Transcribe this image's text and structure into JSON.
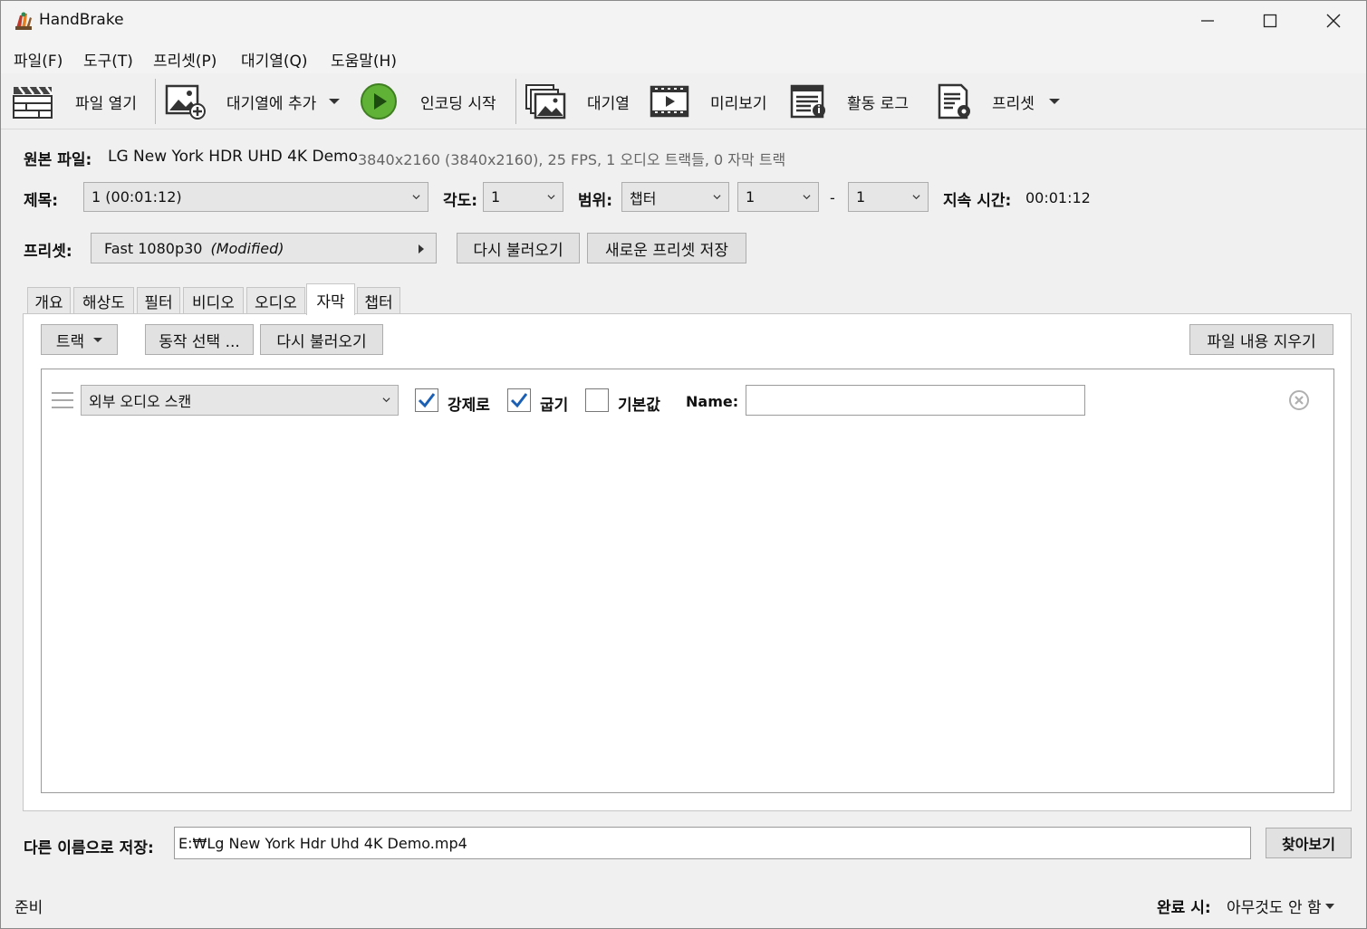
{
  "window": {
    "title": "HandBrake"
  },
  "menu": {
    "items": [
      "파일(F)",
      "도구(T)",
      "프리셋(P)",
      "대기열(Q)",
      "도움말(H)"
    ]
  },
  "toolbar": {
    "open_file": "파일 열기",
    "add_to_queue": "대기열에 추가",
    "start_encode": "인코딩 시작",
    "queue": "대기열",
    "preview": "미리보기",
    "activity_log": "활동 로그",
    "presets": "프리셋"
  },
  "source": {
    "label": "원본 파일:",
    "name": "LG New York HDR UHD 4K Demo",
    "info": "3840x2160 (3840x2160), 25 FPS, 1 오디오 트랙들, 0 자막 트랙"
  },
  "title_row": {
    "title_label": "제목:",
    "title_value": "1  (00:01:12)",
    "angle_label": "각도:",
    "angle_value": "1",
    "range_label": "범위:",
    "range_type": "챕터",
    "range_start": "1",
    "range_dash": "-",
    "range_end": "1",
    "duration_label": "지속 시간:",
    "duration_value": "00:01:12"
  },
  "preset_row": {
    "label": "프리셋:",
    "preset_name": "Fast 1080p30",
    "preset_modified": "(Modified)",
    "reload_button": "다시 불러오기",
    "save_new_button": "새로운 프리셋 저장"
  },
  "tabs": [
    "개요",
    "해상도",
    "필터",
    "비디오",
    "오디오",
    "자막",
    "챕터"
  ],
  "active_tab": "자막",
  "subtitles": {
    "tracks_button": "트랙",
    "behavior_button": "동작 선택 ...",
    "reload_button": "다시 불러오기",
    "clear_button": "파일 내용 지우기",
    "track": {
      "source": "외부 오디오 스캔",
      "forced_label": "강제로",
      "forced_checked": true,
      "burn_label": "굽기",
      "burn_checked": true,
      "default_label": "기본값",
      "default_checked": false,
      "name_label": "Name:",
      "name_value": ""
    }
  },
  "save_as": {
    "label": "다른 이름으로 저장:",
    "path": "E:₩Lg New York Hdr Uhd 4K Demo.mp4",
    "browse_button": "찾아보기"
  },
  "status": {
    "text": "준비",
    "when_done_label": "완료 시:",
    "when_done_value": "아무것도 안 함"
  },
  "colors": {
    "accent_check": "#1a5fb4",
    "play_green": "#5fb236"
  }
}
